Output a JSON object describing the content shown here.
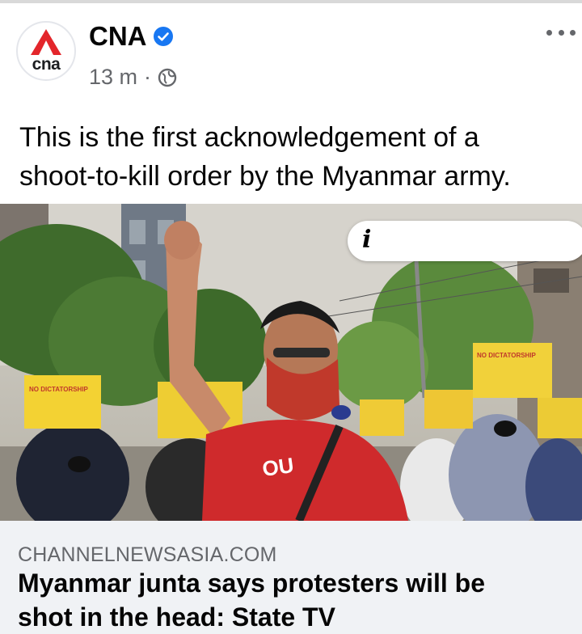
{
  "post": {
    "page_name": "CNA",
    "logo_text": "cna",
    "timestamp": "13 m",
    "separator": "·",
    "text": "This is the first acknowledgement of a\nshoot-to-kill order by the Myanmar army."
  },
  "photo": {
    "placard_text": "NO DICTATORSHIP",
    "shirt_text": "OU",
    "info_icon": "i"
  },
  "link_preview": {
    "domain": "CHANNELNEWSASIA.COM",
    "title": "Myanmar junta says protesters will be\nshot in the head: State TV"
  },
  "icons": {
    "verified": "verified-badge-icon",
    "privacy": "globe-icon",
    "more": "more-options-icon"
  },
  "colors": {
    "brand_red": "#e3262b",
    "verified_blue": "#1877f2",
    "secondary_text": "#65676b",
    "link_background": "#f0f2f5"
  }
}
